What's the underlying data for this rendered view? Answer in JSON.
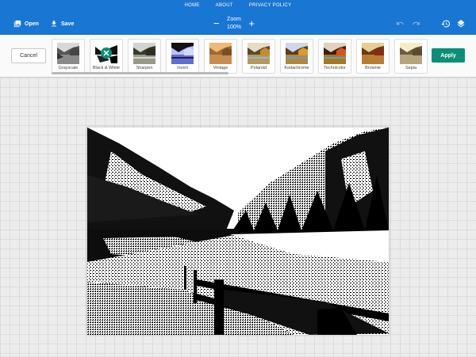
{
  "nav": {
    "items": [
      "HOME",
      "ABOUT",
      "PRIVACY POLICY"
    ]
  },
  "toolbar": {
    "open_label": "Open",
    "save_label": "Save",
    "zoom_label": "Zoom",
    "zoom_value": "100%",
    "zoom_out_symbol": "−",
    "zoom_in_symbol": "+"
  },
  "filterbar": {
    "cancel_label": "Cancel",
    "apply_label": "Apply",
    "filters": [
      {
        "label": "Grayscale"
      },
      {
        "label": "Black & White",
        "active": true
      },
      {
        "label": "Sharpen"
      },
      {
        "label": "Invert"
      },
      {
        "label": "Vintage"
      },
      {
        "label": "Polaroid"
      },
      {
        "label": "Kodachrome"
      },
      {
        "label": "Technicolor"
      },
      {
        "label": "Brownie"
      },
      {
        "label": "Sepia"
      }
    ]
  },
  "colors": {
    "header": "#1976d2",
    "apply": "#0b8f78",
    "canvas_bg": "#ececec"
  },
  "icons": [
    "image-gallery-icon",
    "download-icon",
    "undo-icon",
    "redo-icon",
    "history-icon",
    "layers-icon",
    "close-icon"
  ]
}
